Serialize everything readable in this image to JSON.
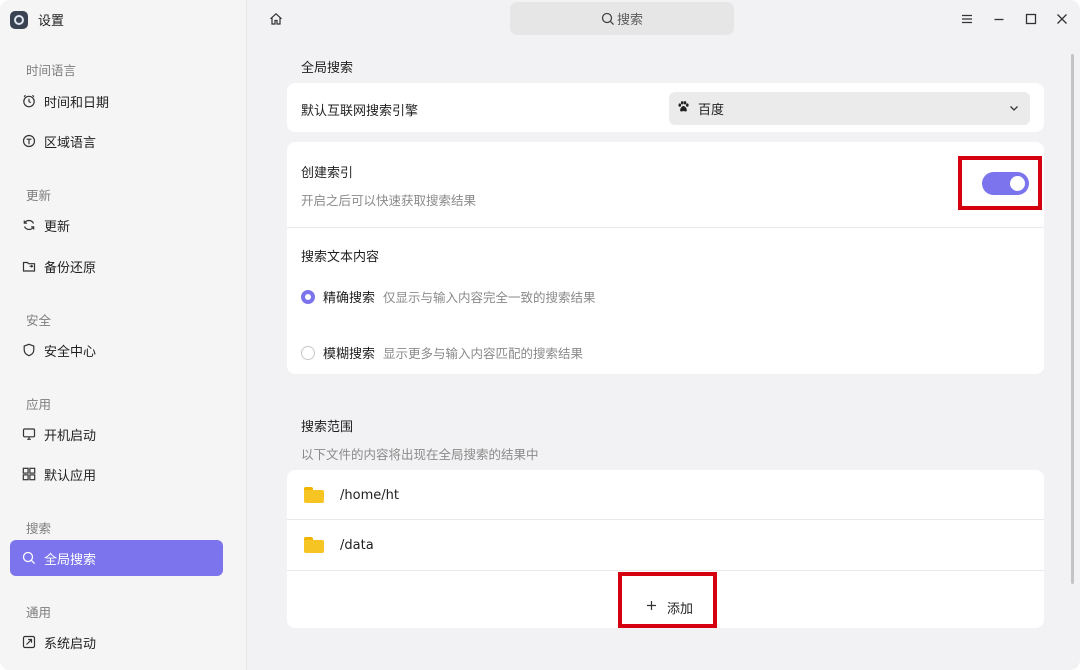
{
  "app": {
    "title": "设置"
  },
  "sidebar": {
    "groups": [
      {
        "label": "时间语言",
        "items": [
          {
            "label": "时间和日期",
            "icon": "clock-icon"
          },
          {
            "label": "区域语言",
            "icon": "region-icon"
          }
        ]
      },
      {
        "label": "更新",
        "items": [
          {
            "label": "更新",
            "icon": "refresh-icon"
          },
          {
            "label": "备份还原",
            "icon": "backup-icon"
          }
        ]
      },
      {
        "label": "安全",
        "items": [
          {
            "label": "安全中心",
            "icon": "shield-icon"
          }
        ]
      },
      {
        "label": "应用",
        "items": [
          {
            "label": "开机启动",
            "icon": "monitor-icon"
          },
          {
            "label": "默认应用",
            "icon": "grid-icon"
          }
        ]
      },
      {
        "label": "搜索",
        "items": [
          {
            "label": "全局搜索",
            "icon": "search-icon",
            "active": true
          }
        ]
      },
      {
        "label": "通用",
        "items": [
          {
            "label": "系统启动",
            "icon": "power-icon"
          }
        ]
      }
    ]
  },
  "topbar": {
    "search_placeholder": "搜索",
    "icons": [
      "home-icon",
      "menu-icon",
      "minimize-icon",
      "maximize-icon",
      "close-icon"
    ]
  },
  "main": {
    "global_search_title": "全局搜索",
    "engine": {
      "label": "默认互联网搜索引擎",
      "value": "百度",
      "icon": "baidu-paw-icon"
    },
    "index": {
      "label": "创建索引",
      "description": "开启之后可以快速获取搜索结果",
      "enabled": true
    },
    "text_content": {
      "title": "搜索文本内容",
      "options": [
        {
          "name": "精确搜索",
          "desc": "仅显示与输入内容完全一致的搜索结果",
          "checked": true
        },
        {
          "name": "模糊搜索",
          "desc": "显示更多与输入内容匹配的搜索结果",
          "checked": false
        }
      ]
    },
    "scope": {
      "title": "搜索范围",
      "description": "以下文件的内容将出现在全局搜索的结果中",
      "paths": [
        "/home/ht",
        "/data"
      ],
      "add_label": "添加"
    }
  },
  "colors": {
    "accent": "#7b74ed",
    "highlight": "#d4000f",
    "folder": "#f7c523"
  }
}
